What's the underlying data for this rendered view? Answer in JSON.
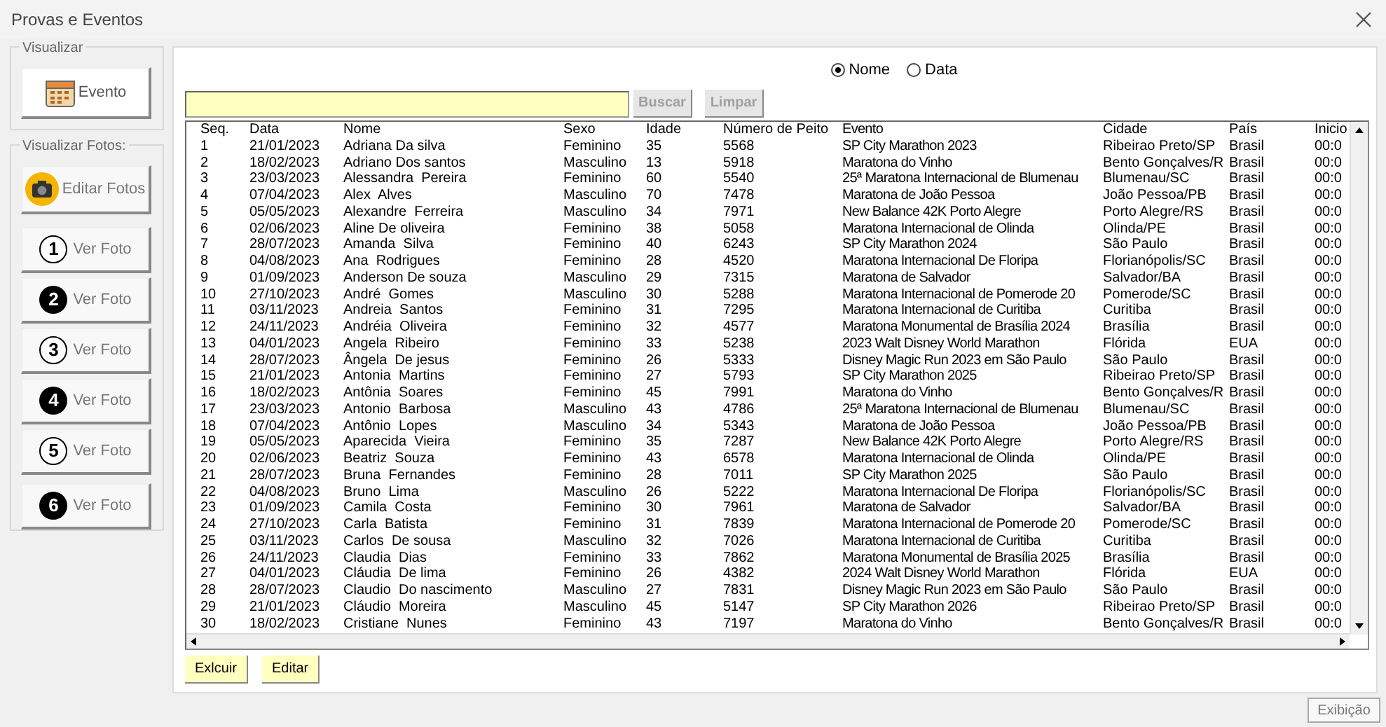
{
  "window": {
    "title": "Provas e Eventos"
  },
  "sidebar": {
    "visualizar": {
      "title": "Visualizar",
      "button": "Evento"
    },
    "fotos": {
      "title": "Visualizar Fotos:",
      "edit_button": "Editar Fotos",
      "items": [
        {
          "number": "1",
          "kind": "outline",
          "label": "Ver Foto"
        },
        {
          "number": "2",
          "kind": "solid",
          "label": "Ver Foto"
        },
        {
          "number": "3",
          "kind": "outline",
          "label": "Ver Foto"
        },
        {
          "number": "4",
          "kind": "solid",
          "label": "Ver Foto"
        },
        {
          "number": "5",
          "kind": "outline",
          "label": "Ver Foto"
        },
        {
          "number": "6",
          "kind": "solid",
          "label": "Ver Foto"
        }
      ]
    }
  },
  "search": {
    "options": [
      {
        "label": "Nome",
        "selected": true
      },
      {
        "label": "Data",
        "selected": false
      }
    ],
    "buttons": [
      {
        "label": "Buscar",
        "disabled": true
      },
      {
        "label": "Limpar",
        "disabled": true
      }
    ]
  },
  "table": {
    "columns": [
      "Seq.",
      "Data",
      "Nome",
      "Sexo",
      "Idade",
      "Número de Peito",
      "Evento",
      "Cidade",
      "País",
      "Inicio"
    ],
    "rows": [
      [
        "1",
        "21/01/2023",
        "Adriana Da silva",
        "Feminino",
        "35",
        "5568",
        "SP City Marathon 2023",
        "Ribeirao Preto/SP",
        "Brasil",
        "00:0"
      ],
      [
        "2",
        "18/02/2023",
        "Adriano Dos santos",
        "Masculino",
        "13",
        "5918",
        "Maratona do Vinho",
        "Bento Gonçalves/R",
        "Brasil",
        "00:0"
      ],
      [
        "3",
        "23/03/2023",
        "Alessandra  Pereira",
        "Feminino",
        "60",
        "5540",
        "25ª Maratona Internacional de Blumenau",
        "Blumenau/SC",
        "Brasil",
        "00:0"
      ],
      [
        "4",
        "07/04/2023",
        "Alex  Alves",
        "Masculino",
        "70",
        "7478",
        "Maratona de João Pessoa",
        "João Pessoa/PB",
        "Brasil",
        "00:0"
      ],
      [
        "5",
        "05/05/2023",
        "Alexandre  Ferreira",
        "Masculino",
        "34",
        "7971",
        "New Balance 42K Porto Alegre",
        "Porto Alegre/RS",
        "Brasil",
        "00:0"
      ],
      [
        "6",
        "02/06/2023",
        "Aline De oliveira",
        "Feminino",
        "38",
        "5058",
        "Maratona Internacional de Olinda",
        "Olinda/PE",
        "Brasil",
        "00:0"
      ],
      [
        "7",
        "28/07/2023",
        "Amanda  Silva",
        "Feminino",
        "40",
        "6243",
        "SP City Marathon 2024",
        "São Paulo",
        "Brasil",
        "00:0"
      ],
      [
        "8",
        "04/08/2023",
        "Ana  Rodrigues",
        "Feminino",
        "28",
        "4520",
        "Maratona Internacional De Floripa",
        "Florianópolis/SC",
        "Brasil",
        "00:0"
      ],
      [
        "9",
        "01/09/2023",
        "Anderson De souza",
        "Masculino",
        "29",
        "7315",
        "Maratona de Salvador",
        "Salvador/BA",
        "Brasil",
        "00:0"
      ],
      [
        "10",
        "27/10/2023",
        "André  Gomes",
        "Masculino",
        "30",
        "5288",
        "Maratona Internacional de Pomerode 20",
        "Pomerode/SC",
        "Brasil",
        "00:0"
      ],
      [
        "11",
        "03/11/2023",
        "Andreia  Santos",
        "Feminino",
        "31",
        "7295",
        "Maratona Internacional de Curitiba",
        "Curitiba",
        "Brasil",
        "00:0"
      ],
      [
        "12",
        "24/11/2023",
        "Andréia  Oliveira",
        "Feminino",
        "32",
        "4577",
        "Maratona Monumental de Brasília 2024",
        "Brasília",
        "Brasil",
        "00:0"
      ],
      [
        "13",
        "04/01/2023",
        "Angela  Ribeiro",
        "Feminino",
        "33",
        "5238",
        "2023 Walt Disney World Marathon",
        "Flórida",
        "EUA",
        "00:0"
      ],
      [
        "14",
        "28/07/2023",
        "Ângela  De jesus",
        "Feminino",
        "26",
        "5333",
        "Disney Magic Run 2023 em São Paulo",
        "São Paulo",
        "Brasil",
        "00:0"
      ],
      [
        "15",
        "21/01/2023",
        "Antonia  Martins",
        "Feminino",
        "27",
        "5793",
        "SP City Marathon 2025",
        "Ribeirao Preto/SP",
        "Brasil",
        "00:0"
      ],
      [
        "16",
        "18/02/2023",
        "Antônia  Soares",
        "Feminino",
        "45",
        "7991",
        "Maratona do Vinho",
        "Bento Gonçalves/R",
        "Brasil",
        "00:0"
      ],
      [
        "17",
        "23/03/2023",
        "Antonio  Barbosa",
        "Masculino",
        "43",
        "4786",
        "25ª Maratona Internacional de Blumenau",
        "Blumenau/SC",
        "Brasil",
        "00:0"
      ],
      [
        "18",
        "07/04/2023",
        "Antônio  Lopes",
        "Masculino",
        "34",
        "5343",
        "Maratona de João Pessoa",
        "João Pessoa/PB",
        "Brasil",
        "00:0"
      ],
      [
        "19",
        "05/05/2023",
        "Aparecida  Vieira",
        "Feminino",
        "35",
        "7287",
        "New Balance 42K Porto Alegre",
        "Porto Alegre/RS",
        "Brasil",
        "00:0"
      ],
      [
        "20",
        "02/06/2023",
        "Beatriz  Souza",
        "Feminino",
        "43",
        "6578",
        "Maratona Internacional de Olinda",
        "Olinda/PE",
        "Brasil",
        "00:0"
      ],
      [
        "21",
        "28/07/2023",
        "Bruna  Fernandes",
        "Feminino",
        "28",
        "7011",
        "SP City Marathon 2025",
        "São Paulo",
        "Brasil",
        "00:0"
      ],
      [
        "22",
        "04/08/2023",
        "Bruno  Lima",
        "Masculino",
        "26",
        "5222",
        "Maratona Internacional De Floripa",
        "Florianópolis/SC",
        "Brasil",
        "00:0"
      ],
      [
        "23",
        "01/09/2023",
        "Camila  Costa",
        "Feminino",
        "30",
        "7961",
        "Maratona de Salvador",
        "Salvador/BA",
        "Brasil",
        "00:0"
      ],
      [
        "24",
        "27/10/2023",
        "Carla  Batista",
        "Feminino",
        "31",
        "7839",
        "Maratona Internacional de Pomerode 20",
        "Pomerode/SC",
        "Brasil",
        "00:0"
      ],
      [
        "25",
        "03/11/2023",
        "Carlos  De sousa",
        "Masculino",
        "32",
        "7026",
        "Maratona Internacional de Curitiba",
        "Curitiba",
        "Brasil",
        "00:0"
      ],
      [
        "26",
        "24/11/2023",
        "Claudia  Dias",
        "Feminino",
        "33",
        "7862",
        "Maratona Monumental de Brasília 2025",
        "Brasília",
        "Brasil",
        "00:0"
      ],
      [
        "27",
        "04/01/2023",
        "Cláudia  De lima",
        "Feminino",
        "26",
        "4382",
        "2024 Walt Disney World Marathon",
        "Flórida",
        "EUA",
        "00:0"
      ],
      [
        "28",
        "28/07/2023",
        "Claudio  Do nascimento",
        "Masculino",
        "27",
        "7831",
        "Disney Magic Run 2023 em São Paulo",
        "São Paulo",
        "Brasil",
        "00:0"
      ],
      [
        "29",
        "21/01/2023",
        "Cláudio  Moreira",
        "Masculino",
        "45",
        "5147",
        "SP City Marathon 2026",
        "Ribeirao Preto/SP",
        "Brasil",
        "00:0"
      ],
      [
        "30",
        "18/02/2023",
        "Cristiane  Nunes",
        "Feminino",
        "43",
        "7197",
        "Maratona do Vinho",
        "Bento Gonçalves/R",
        "Brasil",
        "00:0"
      ]
    ]
  },
  "actions": [
    "Exlcuir",
    "Editar"
  ],
  "footer_button": "Exibição"
}
